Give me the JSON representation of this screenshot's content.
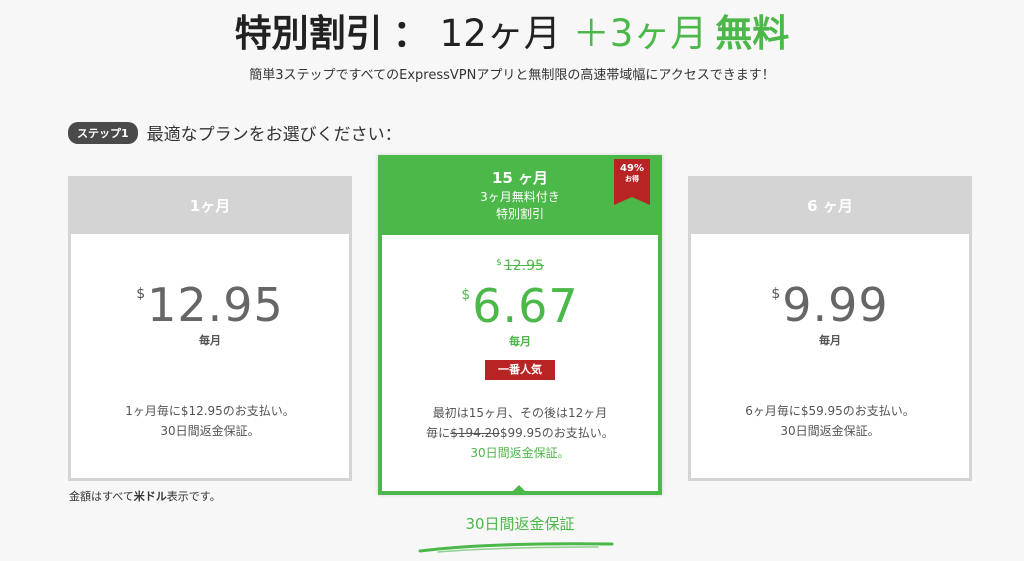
{
  "headline": {
    "main": "特別割引",
    "colon": "：",
    "months": "12ヶ月",
    "plus": "＋3ヶ月",
    "free": "無料"
  },
  "subline": "簡単3ステップですべてのExpressVPNアプリと無制限の高速帯域幅にアクセスできます！",
  "step": {
    "badge": "ステップ1",
    "text": "最適なプランをお選びください："
  },
  "plans": {
    "one_month": {
      "header": "1ヶ月",
      "currency": "$",
      "price": "12.95",
      "per": "毎月",
      "desc_line1": "1ヶ月毎に$12.95のお支払い。",
      "desc_line2": "30日間返金保証。"
    },
    "fifteen_month": {
      "header_line1": "15 ヶ月",
      "header_line2": "3ヶ月無料付き",
      "header_line3": "特別割引",
      "ribbon_pct": "49%",
      "ribbon_label": "お得",
      "old_currency": "$",
      "old_price": "12.95",
      "currency": "$",
      "price": "6.67",
      "per": "毎月",
      "popular": "一番人気",
      "desc_line1": "最初は15ヶ月、その後は12ヶ月",
      "desc_line2_prefix": "毎に",
      "desc_line2_strike": "$194.20",
      "desc_line2_suffix": "$99.95のお支払い。",
      "desc_line3": "30日間返金保証。"
    },
    "six_month": {
      "header": "6 ヶ月",
      "currency": "$",
      "price": "9.99",
      "per": "毎月",
      "desc_line1": "6ヶ月毎に$59.95のお支払い。",
      "desc_line2": "30日間返金保証。"
    }
  },
  "footnote": {
    "prefix": "金額はすべて",
    "bold": "米ドル",
    "suffix": "表示です。"
  },
  "guarantee": "30日間返金保証",
  "colors": {
    "accent_green": "#4cb84a",
    "ribbon_red": "#b82323",
    "side_header_gray": "#d4d4d4"
  }
}
